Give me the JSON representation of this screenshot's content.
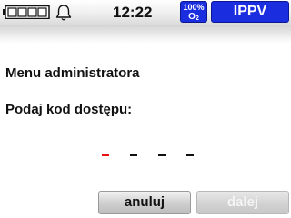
{
  "status_bar": {
    "battery_icon": "battery-icon",
    "battery_level": 0.0,
    "alarm_icon": "bell-icon",
    "time": "12:22",
    "oxygen": {
      "percent": "100%",
      "gas": "O",
      "gas_subscript": "2"
    },
    "mode": "IPPV"
  },
  "main": {
    "menu_title": "Menu administratora",
    "prompt": "Podaj kod dostępu:",
    "code_length": 4,
    "active_digit_index": 0
  },
  "buttons": {
    "cancel_label": "anuluj",
    "next_label": "dalej",
    "next_enabled": false
  },
  "colors": {
    "badge_blue": "#1a2ee0",
    "active_digit": "#e81010",
    "inactive_digit": "#111111"
  }
}
